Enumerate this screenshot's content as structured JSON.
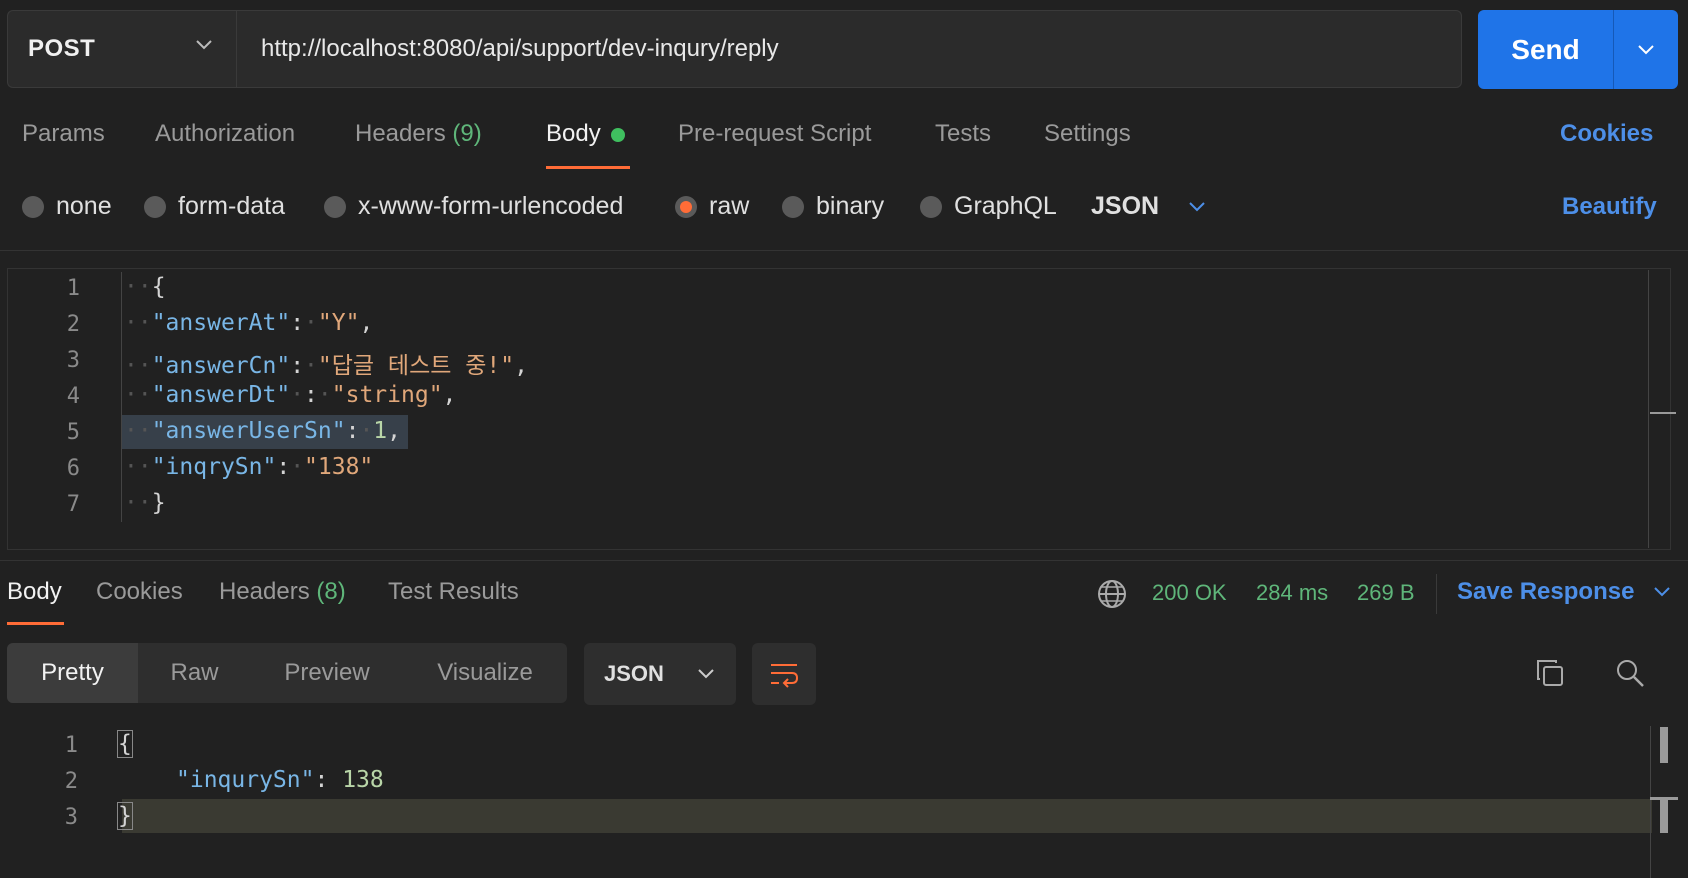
{
  "request": {
    "method": "POST",
    "url": "http://localhost:8080/api/support/dev-inqury/reply",
    "send_label": "Send"
  },
  "request_tabs": {
    "params": "Params",
    "authorization": "Authorization",
    "headers": "Headers",
    "headers_count": "(9)",
    "body": "Body",
    "prerequest": "Pre-request Script",
    "tests": "Tests",
    "settings": "Settings",
    "cookies": "Cookies"
  },
  "body_types": {
    "none": "none",
    "form_data": "form-data",
    "urlencoded": "x-www-form-urlencoded",
    "raw": "raw",
    "binary": "binary",
    "graphql": "GraphQL",
    "format": "JSON",
    "beautify": "Beautify",
    "selected": "raw"
  },
  "editor": {
    "line_numbers": [
      "1",
      "2",
      "3",
      "4",
      "5",
      "6",
      "7"
    ],
    "lines": {
      "l1_open": "{",
      "l2_key": "\"answerAt\"",
      "l2_val": "\"Y\"",
      "l3_key": "\"answerCn\"",
      "l3_val": "\"답글 테스트 중!\"",
      "l4_key": "\"answerDt\"",
      "l4_val": "\"string\"",
      "l5_key": "\"answerUserSn\"",
      "l5_val": "1",
      "l6_key": "\"inqrySn\"",
      "l6_val": "\"138\"",
      "l7_close": "}"
    }
  },
  "response_tabs": {
    "body": "Body",
    "cookies": "Cookies",
    "headers": "Headers",
    "headers_count": "(8)",
    "test_results": "Test Results"
  },
  "response_status": {
    "status": "200 OK",
    "time": "284 ms",
    "size": "269 B",
    "save": "Save Response"
  },
  "response_view": {
    "pretty": "Pretty",
    "raw": "Raw",
    "preview": "Preview",
    "visualize": "Visualize",
    "format": "JSON"
  },
  "response_body": {
    "line_numbers": [
      "1",
      "2",
      "3"
    ],
    "open": "{",
    "key": "\"inqurySn\"",
    "val": "138",
    "close": "}"
  },
  "colors": {
    "accent": "#ff6c37",
    "send": "#1f74e8",
    "link": "#4d8fe8",
    "success": "#5fb67a"
  }
}
